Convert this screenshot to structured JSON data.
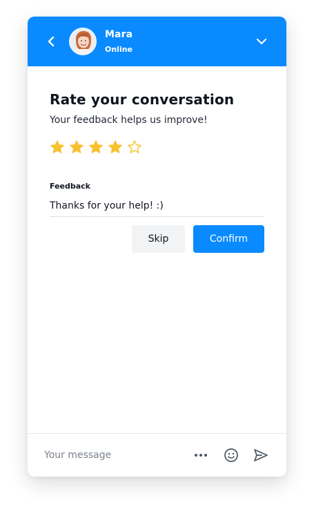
{
  "header": {
    "agent_name": "Mara",
    "agent_status": "Online",
    "back_icon": "chevron-left-icon",
    "collapse_icon": "chevron-down-icon",
    "accent_color": "#0a8aff"
  },
  "rating": {
    "title": "Rate your conversation",
    "subtitle": "Your feedback helps us improve!",
    "stars_total": 5,
    "stars_selected": 4,
    "star_color": "#f8c12f"
  },
  "feedback": {
    "label": "Feedback",
    "value": "Thanks for your help! :)"
  },
  "actions": {
    "skip_label": "Skip",
    "confirm_label": "Confirm"
  },
  "composer": {
    "placeholder": "Your message",
    "icons": [
      "more-icon",
      "emoji-icon",
      "send-icon"
    ]
  }
}
